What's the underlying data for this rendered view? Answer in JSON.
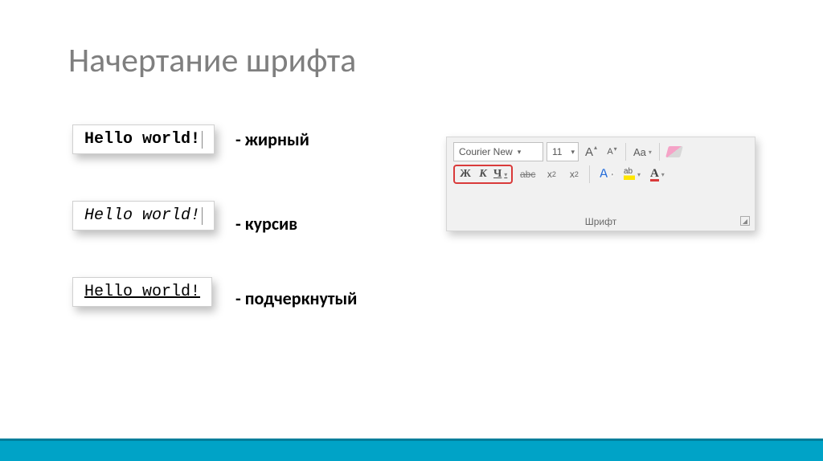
{
  "title": "Начертание шрифта",
  "samples": {
    "bold_text": "Hello world!",
    "italic_text": "Hello world!",
    "underline_text": "Hello world!"
  },
  "labels": {
    "bold": "- жирный",
    "italic": "- курсив",
    "underline": "- подчеркнутый"
  },
  "ribbon": {
    "font_name": "Courier New",
    "font_size": "11",
    "grow_font": "A",
    "shrink_font": "A",
    "change_case": "Aa",
    "bold_btn": "Ж",
    "italic_btn": "К",
    "underline_btn": "Ч",
    "strike": "abc",
    "subscript": "x",
    "subscript_sub": "2",
    "superscript": "x",
    "superscript_sup": "2",
    "text_effects": "A",
    "highlight_hint": "ab",
    "font_color": "A",
    "group_label": "Шрифт"
  }
}
